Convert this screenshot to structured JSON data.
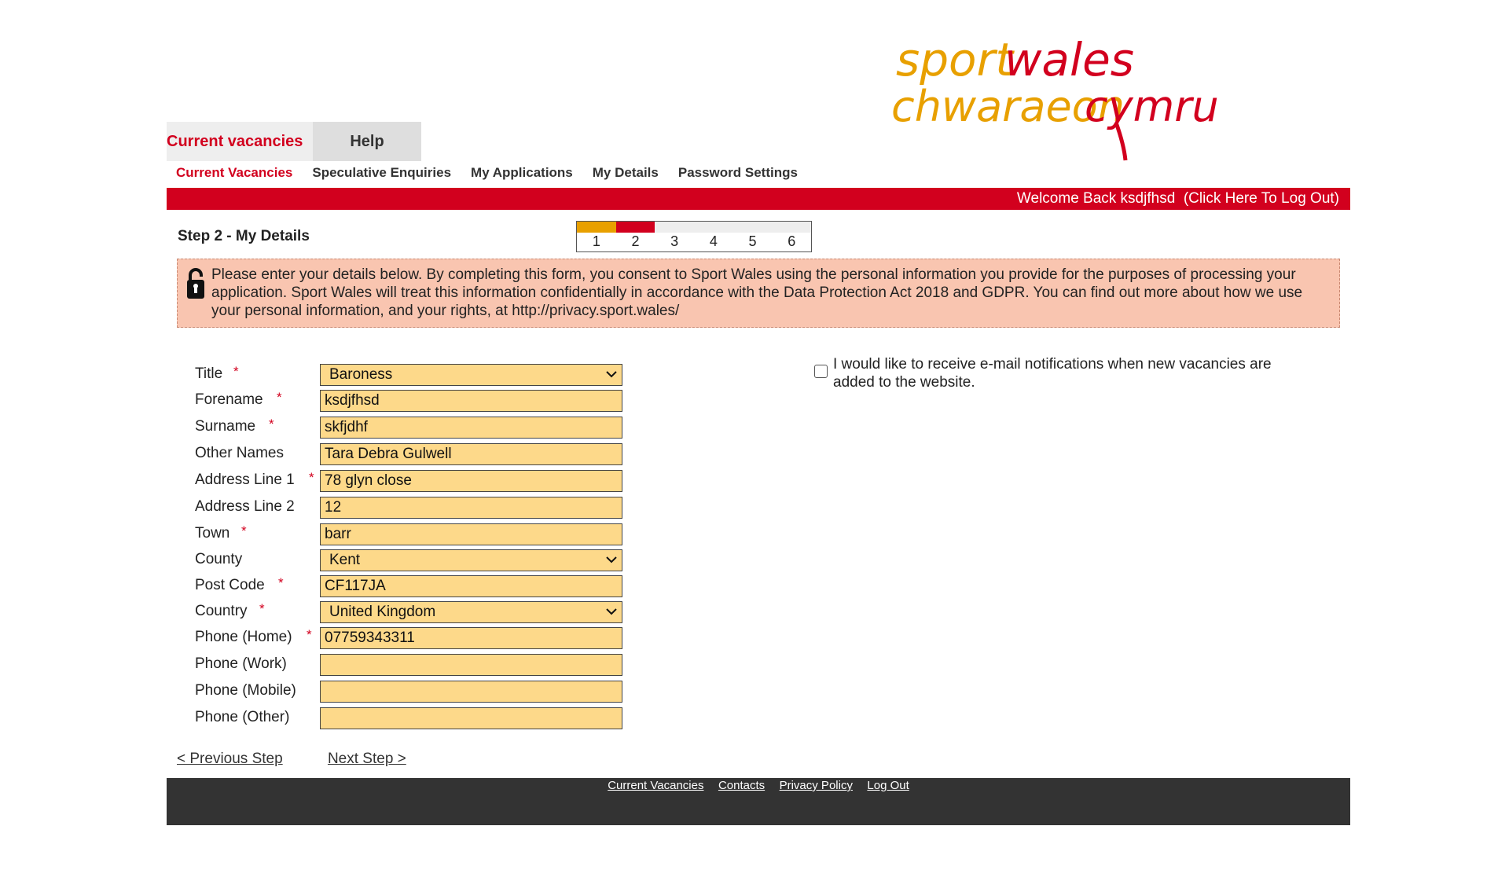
{
  "logo": {
    "line1a": "sport",
    "line1b": "wales",
    "line2a": "chwaraeon",
    "line2b": "cymru"
  },
  "top_tabs": [
    "Current vacancies",
    "Help"
  ],
  "sub_nav": [
    "Current Vacancies",
    "Speculative Enquiries",
    "My Applications",
    "My Details",
    "Password Settings"
  ],
  "welcome": "Welcome Back ksdjfhsd",
  "logout": "(Click Here To Log Out)",
  "step": {
    "title": "Step 2 - My Details",
    "numbers": [
      "1",
      "2",
      "3",
      "4",
      "5",
      "6"
    ],
    "current": 2,
    "colors": {
      "done": "#e8a000",
      "current": "#d2001e",
      "todo": "#eeeeee"
    }
  },
  "notice": "Please enter your details below.  By completing this form, you consent to Sport Wales using the personal information you provide for the purposes of processing your application. Sport Wales will treat this information confidentially in accordance with the Data Protection Act 2018 and GDPR. You can find out more about how we use your personal information, and your rights, at http://privacy.sport.wales/",
  "form": {
    "fields": [
      {
        "label": "Title",
        "required": true,
        "value": "Baroness",
        "type": "select"
      },
      {
        "label": "Forename",
        "required": true,
        "value": "ksdjfhsd",
        "type": "text"
      },
      {
        "label": "Surname",
        "required": true,
        "value": "skfjdhf",
        "type": "text"
      },
      {
        "label": "Other Names",
        "required": false,
        "value": "Tara Debra Gulwell",
        "type": "text"
      },
      {
        "label": "Address Line 1",
        "required": true,
        "value": "78 glyn close",
        "type": "text"
      },
      {
        "label": "Address Line 2",
        "required": false,
        "value": "12",
        "type": "text"
      },
      {
        "label": "Town",
        "required": true,
        "value": "barr",
        "type": "text"
      },
      {
        "label": "County",
        "required": false,
        "value": "Kent",
        "type": "select"
      },
      {
        "label": "Post Code",
        "required": true,
        "value": "CF117JA",
        "type": "text"
      },
      {
        "label": "Country",
        "required": true,
        "value": "United Kingdom",
        "type": "select"
      },
      {
        "label": "Phone (Home)",
        "required": true,
        "value": "07759343311",
        "type": "text"
      },
      {
        "label": "Phone (Work)",
        "required": false,
        "value": "",
        "type": "text"
      },
      {
        "label": "Phone (Mobile)",
        "required": false,
        "value": "",
        "type": "text"
      },
      {
        "label": "Phone (Other)",
        "required": false,
        "value": "",
        "type": "text"
      }
    ],
    "required_mark": "*"
  },
  "notify_text": "I would like to receive e-mail notifications when new vacancies are added to the website.",
  "step_links": {
    "previous": "< Previous Step",
    "next": "Next Step >"
  },
  "footer_links": [
    "Current Vacancies",
    "Contacts",
    "Privacy Policy",
    "Log Out"
  ],
  "colors": {
    "brand_red": "#d2001e",
    "brand_gold": "#e8a000",
    "field_bg": "#fdd98a",
    "notice_bg": "#f9c5b0"
  }
}
